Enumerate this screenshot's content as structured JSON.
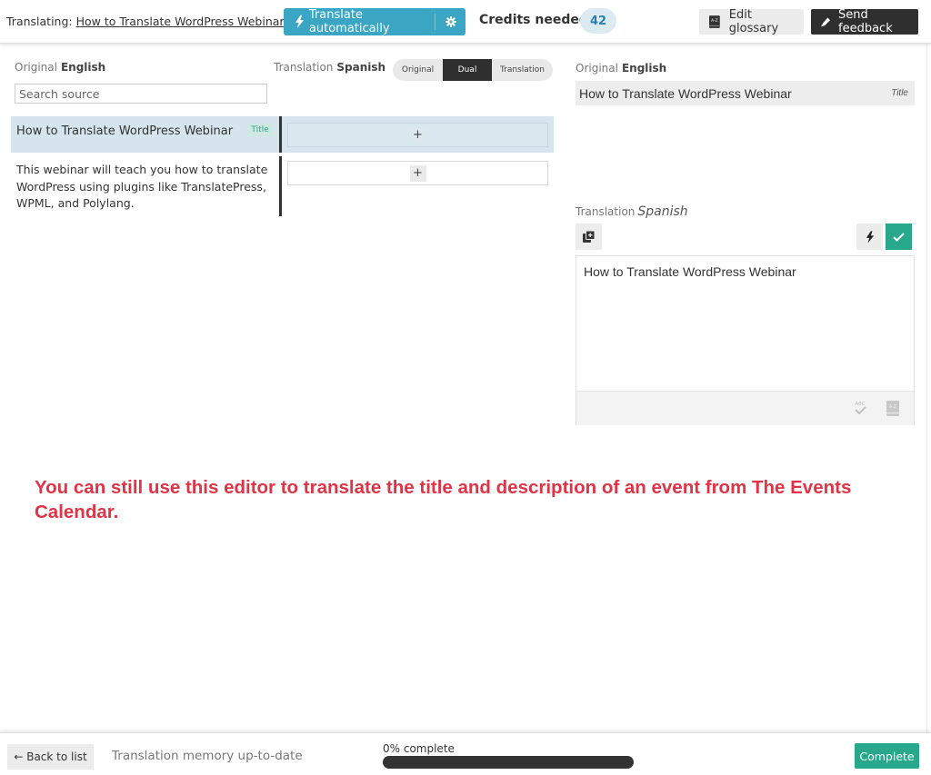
{
  "header": {
    "translating_prefix": "Translating:",
    "document_title": "How to Translate WordPress Webinar",
    "external_link_icon": "external-link-icon",
    "translate_auto_label": "Translate automatically",
    "translate_auto_icon": "lightning-bolt-icon",
    "settings_icon": "gear-icon",
    "credits_label": "Credits needed",
    "credits_value": "42",
    "edit_glossary_label": "Edit glossary",
    "edit_glossary_icon": "glossary-book-icon",
    "send_feedback_label": "Send feedback",
    "send_feedback_icon": "pencil-icon"
  },
  "list_panel": {
    "original_label": "Original",
    "original_language": "English",
    "translation_label": "Translation",
    "translation_language": "Spanish",
    "search_placeholder": "Search source",
    "search_value": "",
    "view_modes": [
      "Original",
      "Dual",
      "Translation"
    ],
    "active_view_mode": "Dual",
    "rows": [
      {
        "source": "How to Translate WordPress Webinar",
        "tag": "Title",
        "translation": "",
        "add_label": "+",
        "selected": true
      },
      {
        "source": "This webinar will teach you how to translate WordPress using plugins like TranslatePress, WPML, and Polylang.",
        "tag": "",
        "translation": "",
        "add_label": "+",
        "selected": false
      }
    ]
  },
  "editor_panel": {
    "original_label": "Original",
    "original_language": "English",
    "original_text": "How to Translate WordPress Webinar",
    "original_tag": "Title",
    "translation_label": "Translation",
    "translation_language": "Spanish",
    "copy_icon": "copy-source-icon",
    "auto_translate_icon": "lightning-bolt-icon",
    "confirm_icon": "checkmark-icon",
    "translation_text": "How to Translate WordPress Webinar",
    "spellcheck_icon": "spellcheck-abc-icon",
    "glossary_icon": "glossary-book-icon"
  },
  "annotation": {
    "text": "You can still use this editor to translate the title and description of an event from The Events Calendar."
  },
  "footer": {
    "back_label": "← Back to list",
    "tm_status": "Translation memory up-to-date",
    "progress_label": "0% complete",
    "progress_percent": 0,
    "complete_label": "Complete"
  },
  "colors": {
    "accent_blue": "#3aa6c4",
    "accent_green": "#27a88b",
    "annotation_red": "#e03345",
    "selected_row": "#d5e4ed",
    "dark_button": "#2f2f2f"
  }
}
